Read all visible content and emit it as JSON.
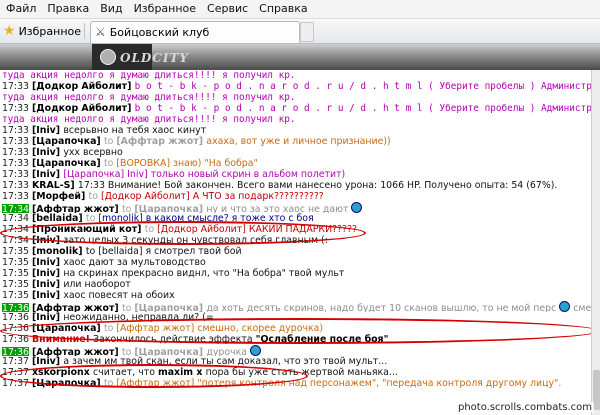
{
  "menu": [
    "Файл",
    "Правка",
    "Вид",
    "Избранное",
    "Сервис",
    "Справка"
  ],
  "favorites_label": "Избранное",
  "tab_title": "Бойцовский клуб",
  "logo_text": "OLDCITY",
  "watermark": "photo.scrolls.combats.com",
  "chat": {
    "lines": [
      {
        "parts": [
          {
            "c": "sys",
            "t": "туда акция недолго я думаю длиться!!!! я получил кр."
          }
        ]
      },
      {
        "parts": [
          {
            "c": "t",
            "t": "17:33 "
          },
          {
            "c": "n",
            "t": "[Додкор Айболит] "
          },
          {
            "c": "sys",
            "t": "b o t - b k - p o d . n a r o d . r u / d . h t m l ( Уберите пробелы ) Администрация Игры дарует нам по"
          }
        ]
      },
      {
        "parts": [
          {
            "c": "sys",
            "t": "туда акция недолго я думаю длиться!!!! я получил кр."
          }
        ]
      },
      {
        "parts": [
          {
            "c": "t",
            "t": "17:33 "
          },
          {
            "c": "n",
            "t": "[Додкор Айболит] "
          },
          {
            "c": "sys",
            "t": "b o t - b k - p o d . n a r o d . r u / d . h t m l ( Уберите пробелы ) Администрация Игры дарует нам по"
          }
        ]
      },
      {
        "parts": [
          {
            "c": "sys",
            "t": "туда акция недолго я думаю длиться!!!! я получил кр."
          }
        ]
      },
      {
        "parts": [
          {
            "c": "t",
            "t": "17:33 "
          },
          {
            "c": "n",
            "t": "[Iniv] "
          },
          {
            "c": "blk",
            "t": "всерьвно на тебя хаос кинут"
          }
        ]
      },
      {
        "parts": [
          {
            "c": "t",
            "t": "17:33 "
          },
          {
            "c": "n",
            "t": "[Царапочка] "
          },
          {
            "c": "to",
            "t": "to "
          },
          {
            "c": "tb",
            "t": "[Аффтар жжот] "
          },
          {
            "c": "or",
            "t": "ахаха, вот уже и личное признание))"
          }
        ]
      },
      {
        "parts": [
          {
            "c": "t",
            "t": "17:33 "
          },
          {
            "c": "n",
            "t": "[Iniv] "
          },
          {
            "c": "blk",
            "t": "ухх всервно"
          }
        ]
      },
      {
        "parts": [
          {
            "c": "t",
            "t": "17:33 "
          },
          {
            "c": "n",
            "t": "[Царапочка] "
          },
          {
            "c": "to",
            "t": "to "
          },
          {
            "c": "or",
            "t": "[ВОРОВКА] знаю) \"На бобра\""
          }
        ]
      },
      {
        "parts": [
          {
            "c": "t",
            "t": "17:33 "
          },
          {
            "c": "n",
            "t": "[Iniv] "
          },
          {
            "c": "pm",
            "t": "[Царапочка] "
          },
          {
            "c": "pm",
            "t": "Iniv] только новый скрин в альбом полетит)"
          }
        ]
      },
      {
        "parts": [
          {
            "c": "t",
            "t": "17:33 "
          },
          {
            "c": "n",
            "t": "KRAL-S] "
          },
          {
            "c": "blk",
            "t": "17:33 Внимание! Бой закончен. Всего вами нанесено урона: 1066 HP. Получено опыта: 54 (67%)."
          }
        ]
      },
      {
        "parts": [
          {
            "c": "t",
            "t": "17:33 "
          },
          {
            "c": "n",
            "t": "[Морфей] "
          },
          {
            "c": "to",
            "t": "to "
          },
          {
            "c": "rd",
            "t": "[Додкор Айболит] А ЧТО за подарк??????????"
          }
        ]
      },
      {
        "parts": [
          {
            "c": "hl",
            "t": "17:34"
          },
          {
            "c": "t",
            "t": " "
          },
          {
            "c": "n",
            "t": "[Аффтар жжот] "
          },
          {
            "c": "to",
            "t": "to "
          },
          {
            "c": "tb",
            "t": "[Царапочка] "
          },
          {
            "c": "gr",
            "t": "ну и что за это хаос не дают "
          },
          {
            "c": "smile",
            "t": ""
          }
        ]
      },
      {
        "parts": [
          {
            "c": "t",
            "t": "17:34 "
          },
          {
            "c": "n",
            "t": "[bellaida] "
          },
          {
            "c": "to",
            "t": "to "
          },
          {
            "c": "bl",
            "t": "[monolik] в каком смысле? я тоже хто с боя"
          }
        ]
      },
      {
        "parts": [
          {
            "c": "t",
            "t": "17:34 "
          },
          {
            "c": "n",
            "t": "[Проникающий кот] "
          },
          {
            "c": "to",
            "t": "to "
          },
          {
            "c": "rd",
            "t": "[Додкор Айболит] КАКИИ ПАДАРКИ?????"
          }
        ]
      },
      {
        "parts": [
          {
            "c": "t",
            "t": "17:34 "
          },
          {
            "c": "n",
            "t": "[Iniv] "
          },
          {
            "c": "blk",
            "t": "зато целых 3 секунды он чувствовал себя главным (:"
          }
        ]
      },
      {
        "parts": [
          {
            "c": "t",
            "t": "17:35 "
          },
          {
            "c": "n",
            "t": "[monolik] "
          },
          {
            "c": "blk",
            "t": "to [bellaida] я смотрел твой бой"
          }
        ]
      },
      {
        "parts": [
          {
            "c": "t",
            "t": "17:35 "
          },
          {
            "c": "n",
            "t": "[Iniv] "
          },
          {
            "c": "blk",
            "t": "хаос дают за мультоводство"
          }
        ]
      },
      {
        "parts": [
          {
            "c": "t",
            "t": "17:35 "
          },
          {
            "c": "n",
            "t": "[Iniv] "
          },
          {
            "c": "blk",
            "t": "на скринах прекрасно виднл, что \"На бобра\" твой мульт"
          }
        ]
      },
      {
        "parts": [
          {
            "c": "t",
            "t": "17:35 "
          },
          {
            "c": "n",
            "t": "[Iniv] "
          },
          {
            "c": "blk",
            "t": "или наоборот"
          }
        ]
      },
      {
        "parts": [
          {
            "c": "t",
            "t": "17:35 "
          },
          {
            "c": "n",
            "t": "[Iniv] "
          },
          {
            "c": "blk",
            "t": "хаос повесят на обоих"
          }
        ]
      },
      {
        "parts": [
          {
            "c": "hl",
            "t": "17:36"
          },
          {
            "c": "t",
            "t": " "
          },
          {
            "c": "n",
            "t": "[Аффтар жжот] "
          },
          {
            "c": "to",
            "t": "to "
          },
          {
            "c": "tb",
            "t": "[Царапочка] "
          },
          {
            "c": "gr",
            "t": "да хоть десять скринов, надо будет 10 сканов вышлю, то не мой перс "
          },
          {
            "c": "smile",
            "t": ""
          },
          {
            "c": "gr",
            "t": " смешная"
          }
        ]
      },
      {
        "parts": [
          {
            "c": "t",
            "t": "17:36 "
          },
          {
            "c": "n",
            "t": "[Iniv] "
          },
          {
            "c": "blk",
            "t": "неожиданно, неправда ли? (="
          }
        ]
      },
      {
        "parts": [
          {
            "c": "t",
            "t": "17:36 "
          },
          {
            "c": "n",
            "t": "[Царапочка] "
          },
          {
            "c": "to",
            "t": "to "
          },
          {
            "c": "or",
            "t": "[Аффтар жжот] смешно, скорее дурочка)"
          }
        ]
      },
      {
        "parts": [
          {
            "c": "t",
            "t": "17:36 "
          },
          {
            "c": "rb",
            "t": "Внимание! "
          },
          {
            "c": "blk",
            "t": "Закончилось действие эффекта "
          },
          {
            "c": "n",
            "t": "\"Ослабление после боя\""
          }
        ]
      },
      {
        "parts": [
          {
            "c": "hl",
            "t": "17:36"
          },
          {
            "c": "t",
            "t": " "
          },
          {
            "c": "n",
            "t": "[Аффтар жжот] "
          },
          {
            "c": "to",
            "t": "to "
          },
          {
            "c": "tb",
            "t": "[Царапочка] "
          },
          {
            "c": "gr",
            "t": "дурочка "
          },
          {
            "c": "smile",
            "t": ""
          }
        ]
      },
      {
        "parts": [
          {
            "c": "t",
            "t": "17:37 "
          },
          {
            "c": "n",
            "t": "[Iniv] "
          },
          {
            "c": "blk",
            "t": "а зачем им твой скан, если ты сам доказал, что это твой мульт..."
          }
        ]
      },
      {
        "parts": [
          {
            "c": "t",
            "t": "17:37 "
          },
          {
            "c": "n",
            "t": "xskorpionx "
          },
          {
            "c": "blk",
            "t": "считает, что "
          },
          {
            "c": "n",
            "t": "maxim x "
          },
          {
            "c": "blk",
            "t": "пора бы уже стать жертвой маньяка..."
          }
        ]
      },
      {
        "parts": [
          {
            "c": "t",
            "t": "17:37 "
          },
          {
            "c": "n",
            "t": "[Царапочка] "
          },
          {
            "c": "to",
            "t": "to "
          },
          {
            "c": "or",
            "t": "[Аффтар жжот] \"потеря контроля над персонажем\", \"передача контроля другому лицу\"."
          }
        ]
      }
    ]
  }
}
